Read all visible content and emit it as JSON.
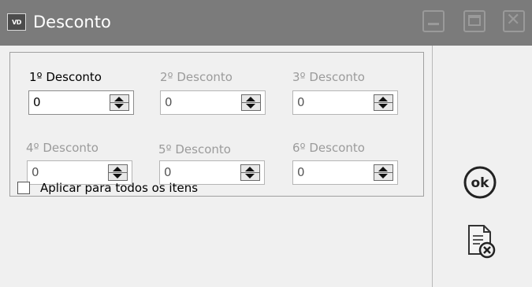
{
  "window": {
    "icon_label": "VD",
    "title": "Desconto"
  },
  "discounts": [
    {
      "label": "1º Desconto",
      "value": "0",
      "enabled": true
    },
    {
      "label": "2º Desconto",
      "value": "0",
      "enabled": false
    },
    {
      "label": "3º Desconto",
      "value": "0",
      "enabled": false
    },
    {
      "label": "4º Desconto",
      "value": "0",
      "enabled": false
    },
    {
      "label": "5º Desconto",
      "value": "0",
      "enabled": false
    },
    {
      "label": "6º Desconto",
      "value": "0",
      "enabled": false
    }
  ],
  "apply_all": {
    "label": "Aplicar para todos os itens",
    "checked": false
  },
  "actions": {
    "ok_label": "ok",
    "ok_icon": "ok-icon",
    "cancel_icon": "document-cancel-icon"
  },
  "colors": {
    "titlebar": "#7b7b7b",
    "disabled_text": "#9b9b9b"
  }
}
